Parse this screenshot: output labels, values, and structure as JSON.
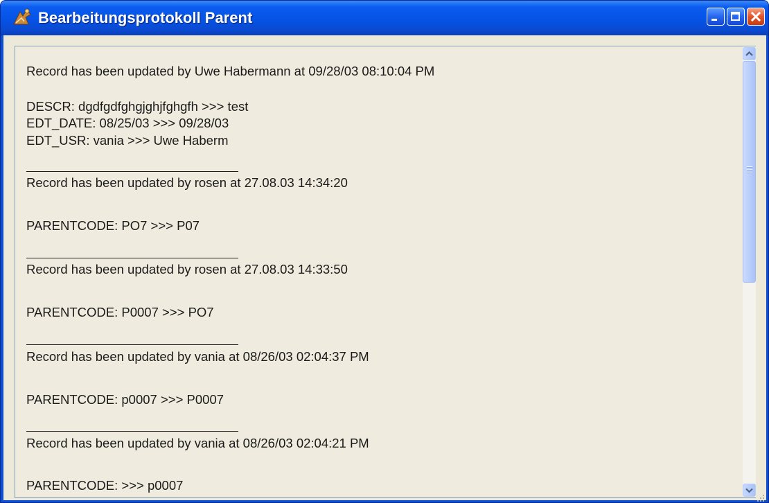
{
  "window": {
    "title": "Bearbeitungsprotokoll Parent"
  },
  "icons": {
    "app": "app-icon",
    "minimize": "minimize-icon",
    "maximize": "maximize-icon",
    "close": "close-icon",
    "scroll_up": "chevron-up-icon",
    "scroll_down": "chevron-down-icon",
    "grip": "grip-icon"
  },
  "colors": {
    "titlebar": "#0653e6",
    "close_button": "#e2542a",
    "client_background": "#ece9d8",
    "textarea_background": "#efebde"
  },
  "log": {
    "lines": [
      "Record has been updated by Uwe Habermann at 09/28/03 08:10:04 PM",
      "DESCR: dgdfgdfghgjghjfghgfh >>> test",
      "EDT_DATE: 08/25/03 >>> 09/28/03",
      "EDT_USR: vania >>> Uwe Haberm",
      "Record has been updated by rosen at 27.08.03 14:34:20",
      "PARENTCODE: PO7 >>> P07",
      "Record has been updated by rosen at 27.08.03 14:33:50",
      "PARENTCODE: P0007 >>> PO7",
      "Record has been updated by vania at 08/26/03 02:04:37 PM",
      "PARENTCODE: p0007 >>> P0007",
      "Record has been updated by vania at 08/26/03 02:04:21 PM",
      "PARENTCODE:  >>> p0007"
    ]
  }
}
